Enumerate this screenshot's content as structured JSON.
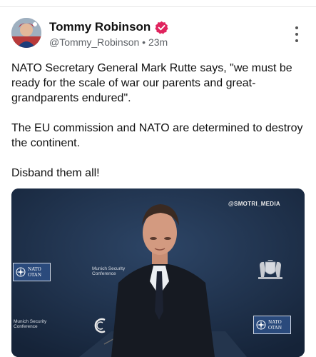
{
  "post": {
    "author_name": "Tommy Robinson",
    "handle": "@Tommy_Robinson",
    "separator": "•",
    "time": "23m",
    "paragraphs": [
      "NATO Secretary General Mark Rutte says, \"we must be ready for the scale of war our parents and great-grandparents endured\".",
      "The EU commission and NATO are determined to destroy the continent.",
      "Disband them all!"
    ]
  },
  "media": {
    "watermark": "@SMOTRI_MEDIA",
    "nato_line1": "NATO",
    "nato_line2": "OTAN",
    "msc_line1": "Munich Security",
    "msc_line2": "Conference"
  },
  "colors": {
    "verified_badge": "#e0245e",
    "text": "#111111",
    "muted": "#5f6368",
    "media_bg": "#1c2d44"
  },
  "icons": {
    "verified": "verified-badge-icon",
    "more": "more-vertical-icon"
  }
}
